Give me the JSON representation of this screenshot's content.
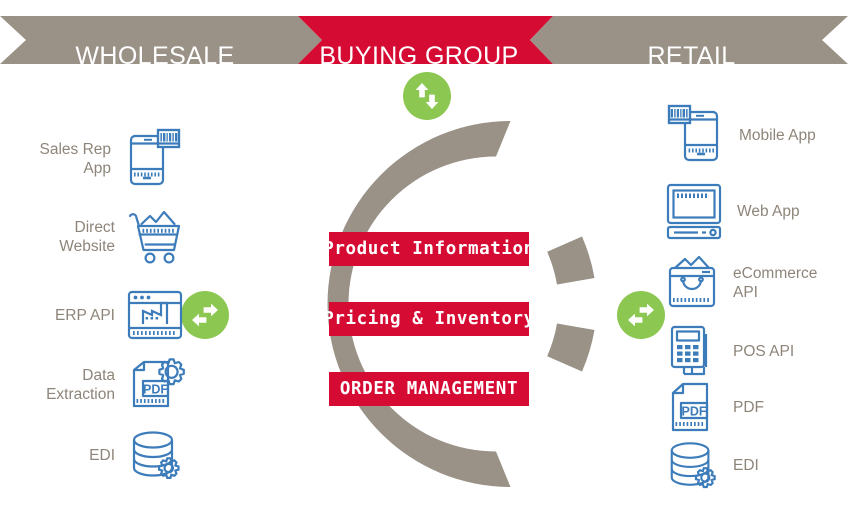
{
  "banner": {
    "segments": [
      {
        "id": "wholesale",
        "label": "WHOLESALE",
        "color": "#9A9187",
        "text_color": "#FFFFFF"
      },
      {
        "id": "buying-group",
        "label": "BUYING GROUP",
        "color": "#D60B33",
        "text_color": "#FFFFFF"
      },
      {
        "id": "retail",
        "label": "RETAIL",
        "color": "#9A9187",
        "text_color": "#FFFFFF"
      }
    ]
  },
  "center": {
    "ring_color": "#9A9187",
    "capabilities": [
      {
        "id": "product-information",
        "label": "Product Information"
      },
      {
        "id": "pricing-inventory",
        "label": "Pricing & Inventory"
      },
      {
        "id": "order-management",
        "label": "ORDER MANAGEMENT"
      }
    ]
  },
  "sync_badges": [
    {
      "id": "sync-top",
      "icon": "sync-vertical-icon",
      "color": "#8CC751"
    },
    {
      "id": "sync-left",
      "icon": "sync-horizontal-icon",
      "color": "#8CC751"
    },
    {
      "id": "sync-right",
      "icon": "sync-horizontal-icon",
      "color": "#8CC751"
    }
  ],
  "wholesale_channels": [
    {
      "id": "sales-rep-app",
      "label": "Sales Rep\nApp",
      "icon": "phone-barcode-icon"
    },
    {
      "id": "direct-website",
      "label": "Direct\nWebsite",
      "icon": "shopping-cart-icon"
    },
    {
      "id": "erp-api",
      "label": "ERP API",
      "icon": "browser-factory-icon"
    },
    {
      "id": "data-extraction",
      "label": "Data\nExtraction",
      "icon": "pdf-gear-icon"
    },
    {
      "id": "edi",
      "label": "EDI",
      "icon": "database-gear-icon"
    }
  ],
  "retail_channels": [
    {
      "id": "mobile-app",
      "label": "Mobile App",
      "icon": "phone-barcode-icon"
    },
    {
      "id": "web-app",
      "label": "Web App",
      "icon": "desktop-computer-icon"
    },
    {
      "id": "ecommerce-api",
      "label": "eCommerce\nAPI",
      "icon": "shopping-bag-icon"
    },
    {
      "id": "pos-api",
      "label": "POS API",
      "icon": "card-terminal-icon"
    },
    {
      "id": "pdf",
      "label": "PDF",
      "icon": "pdf-document-icon"
    },
    {
      "id": "edi",
      "label": "EDI",
      "icon": "database-gear-icon"
    }
  ],
  "colors": {
    "red": "#D60B33",
    "gray": "#9A9187",
    "green": "#8CC751",
    "blue": "#3D7CBA",
    "text_gray": "#8E857A",
    "background": "#FFFFFF"
  }
}
